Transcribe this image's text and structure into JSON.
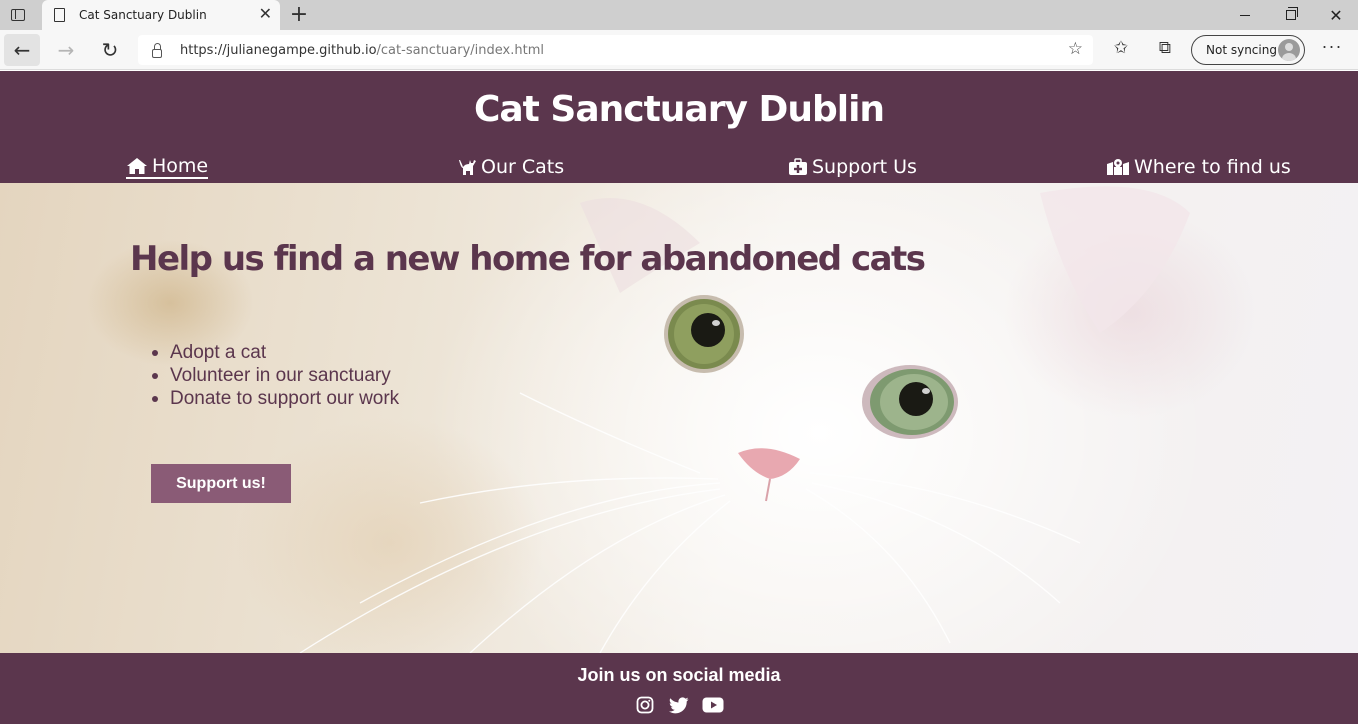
{
  "browser": {
    "tab_title": "Cat Sanctuary Dublin",
    "url_host": "https://julianegampe.github.io",
    "url_path": "/cat-sanctuary/index.html",
    "profile_label": "Not syncing"
  },
  "header": {
    "title": "Cat Sanctuary Dublin",
    "nav": {
      "home": "Home",
      "cats": "Our Cats",
      "support": "Support Us",
      "location": "Where to find us"
    }
  },
  "hero": {
    "heading": "Help us find a new home for abandoned cats",
    "items": [
      "Adopt a cat",
      "Volunteer in our sanctuary",
      "Donate to support our work"
    ],
    "cta": "Support us!"
  },
  "footer": {
    "title": "Join us on social media",
    "icons": [
      "instagram-icon",
      "twitter-icon",
      "youtube-icon"
    ]
  },
  "colors": {
    "brand": "#5b364d",
    "button": "#8a5b76"
  }
}
